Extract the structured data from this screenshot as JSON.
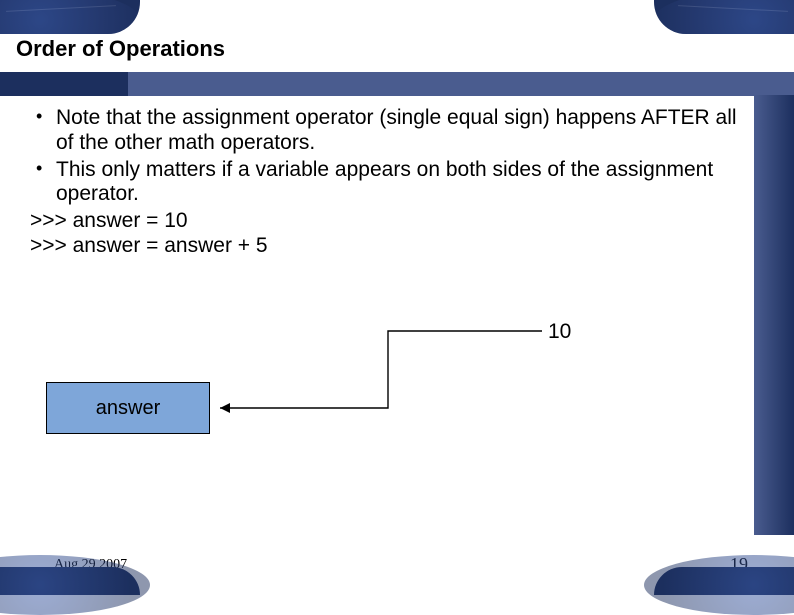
{
  "title": "Order of Operations",
  "bullets": [
    "Note that the assignment operator (single equal sign) happens AFTER all of the other math operators.",
    "This only matters if a variable appears on both sides of the assignment operator."
  ],
  "code_lines": [
    ">>> answer = 10",
    ">>> answer = answer + 5"
  ],
  "diagram": {
    "variable_name": "answer",
    "value": "10"
  },
  "footer": {
    "date": "Aug 29 2007",
    "page_number": "19"
  }
}
